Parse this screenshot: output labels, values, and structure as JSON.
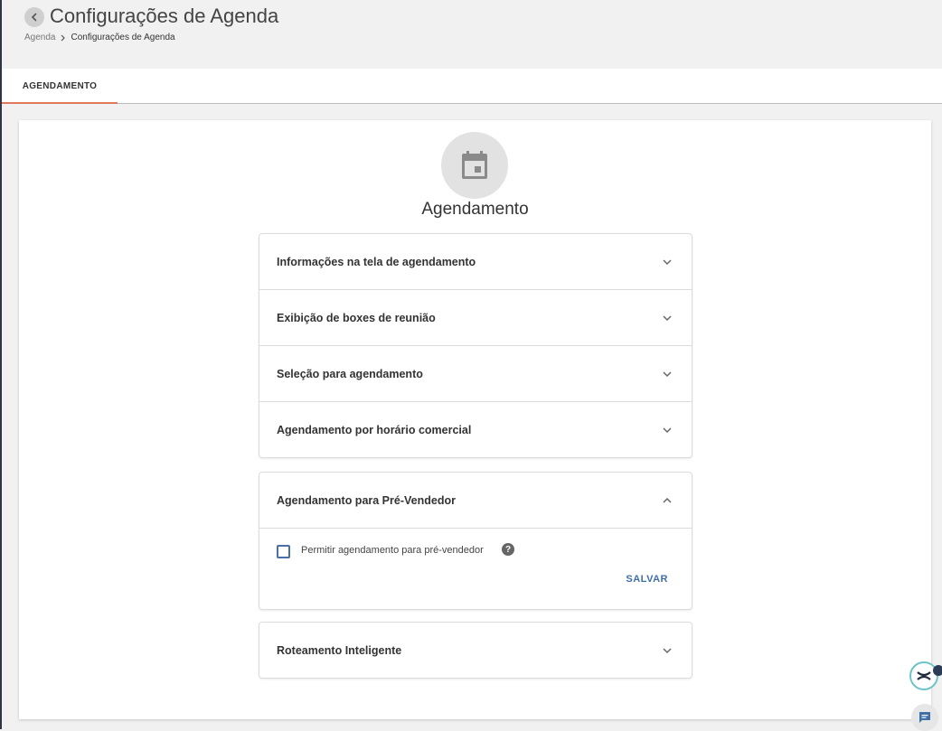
{
  "header": {
    "title": "Configurações de Agenda",
    "breadcrumb": {
      "parent": "Agenda",
      "current": "Configurações de Agenda"
    }
  },
  "tabs": [
    {
      "label": "AGENDAMENTO",
      "active": true
    }
  ],
  "section": {
    "icon": "calendar-icon",
    "title": "Agendamento"
  },
  "panels_group_1": [
    {
      "label": "Informações na tela de agendamento",
      "expanded": false
    },
    {
      "label": "Exibição de boxes de reunião",
      "expanded": false
    },
    {
      "label": "Seleção para agendamento",
      "expanded": false
    },
    {
      "label": "Agendamento por horário comercial",
      "expanded": false
    }
  ],
  "panel_pre_vendedor": {
    "label": "Agendamento para Pré-Vendedor",
    "expanded": true,
    "checkbox_label": "Permitir agendamento para pré-vendedor",
    "checked": false,
    "help": "?",
    "save_label": "SALVAR"
  },
  "panel_roteamento": {
    "label": "Roteamento Inteligente",
    "expanded": false
  },
  "colors": {
    "accent_tab": "#e0785d",
    "primary_button": "#3f6fa8",
    "checkbox_border": "#4a6fa5"
  }
}
